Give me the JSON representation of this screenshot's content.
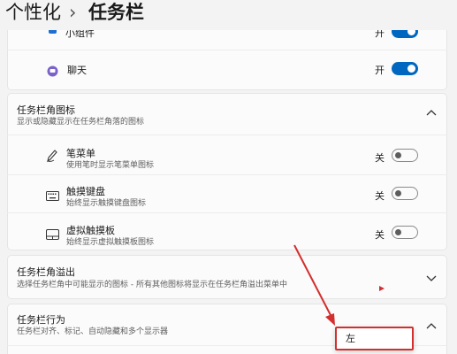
{
  "breadcrumb": {
    "parent": "个性化",
    "separator": "›",
    "current": "任务栏"
  },
  "taskbar_items": [
    {
      "label": "小组件",
      "state_label": "开",
      "on": true
    },
    {
      "label": "聊天",
      "state_label": "开",
      "on": true
    }
  ],
  "corner_icons": {
    "title": "任务栏角图标",
    "desc": "显示或隐藏显示在任务栏角落的图标",
    "items": [
      {
        "label": "笔菜单",
        "desc": "使用笔时显示笔菜单图标",
        "state_label": "关",
        "on": false,
        "icon": "pen-icon"
      },
      {
        "label": "触摸键盘",
        "desc": "始终显示触摸键盘图标",
        "state_label": "关",
        "on": false,
        "icon": "keyboard-icon"
      },
      {
        "label": "虚拟触摸板",
        "desc": "始终显示虚拟触摸板图标",
        "state_label": "关",
        "on": false,
        "icon": "touchpad-icon"
      }
    ]
  },
  "corner_overflow": {
    "title": "任务栏角溢出",
    "desc": "选择任务栏角中可能显示的图标 - 所有其他图标将显示在任务栏角溢出菜单中"
  },
  "behaviors": {
    "title": "任务栏行为",
    "desc": "任务栏对齐、标记、自动隐藏和多个显示器"
  },
  "dropdown": {
    "selected": "左"
  },
  "colors": {
    "accent": "#0067c0",
    "highlight": "#d32f2f"
  }
}
